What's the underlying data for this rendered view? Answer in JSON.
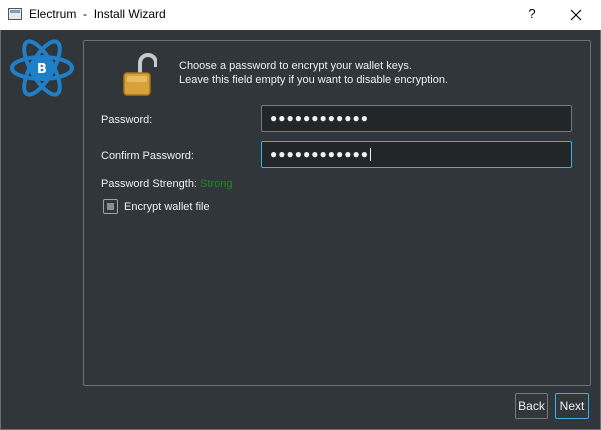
{
  "window": {
    "app_name": "Electrum",
    "separator": "-",
    "title": "Install Wizard",
    "help_glyph": "?",
    "icons": [
      "app-window-icon",
      "help-icon",
      "close-icon",
      "electrum-logo-icon",
      "padlock-icon"
    ]
  },
  "message": {
    "line1": "Choose a password to encrypt your wallet keys.",
    "line2": "Leave this field empty if you want to disable encryption."
  },
  "form": {
    "password_label": "Password:",
    "password_value": "●●●●●●●●●●●●",
    "confirm_label": "Confirm Password:",
    "confirm_value": "●●●●●●●●●●●●",
    "strength_label": "Password Strength:",
    "strength_value": "Strong",
    "encrypt_label": "Encrypt wallet file",
    "encrypt_checked": "partial"
  },
  "buttons": {
    "back": "Back",
    "next": "Next"
  },
  "colors": {
    "background": "#31363b",
    "text": "#eff0f1",
    "input_bg": "#232629",
    "focus": "#3daee9",
    "strength_strong": "#1e8a1e",
    "logo_blue": "#1f80c8"
  }
}
